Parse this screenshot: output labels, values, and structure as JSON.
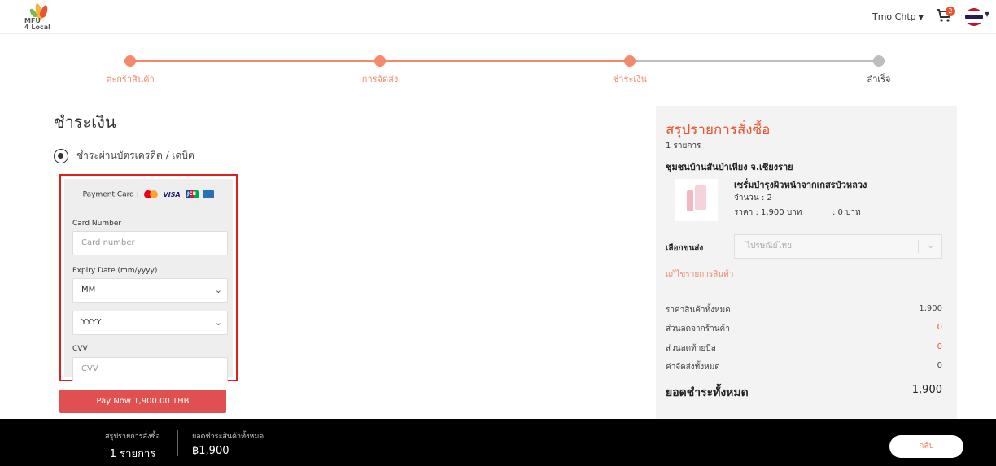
{
  "header": {
    "logo_text": "MFU\n4 Local",
    "user_name": "Tmo Chtp",
    "cart_count": "2"
  },
  "stepper": {
    "steps": [
      {
        "label": "ตะกร้าสินค้า"
      },
      {
        "label": "การจัดส่ง"
      },
      {
        "label": "ชำระเงิน"
      },
      {
        "label": "สำเร็จ"
      }
    ],
    "active_color": "#f58a6b",
    "inactive_color": "#bdbdbd"
  },
  "payment": {
    "title": "ชำระเงิน",
    "method_label": "ชำระผ่านบัตรเครดิต / เดบิต",
    "payment_card_label": "Payment Card :",
    "card_brands": [
      "mastercard-icon",
      "visa-icon",
      "jcb-icon",
      "amex-icon"
    ],
    "card_number_label": "Card Number",
    "card_number_placeholder": "Card number",
    "expiry_label": "Expiry Date (mm/yyyy)",
    "month_value": "MM",
    "year_value": "YYYY",
    "cvv_label": "CVV",
    "cvv_placeholder": "CVV",
    "pay_button": "Pay Now 1,900.00 THB"
  },
  "summary": {
    "title": "สรุปรายการสั่งซื้อ",
    "count": "1 รายการ",
    "shop": "ชุมชนบ้านสันป่าเหียง จ.เชียงราย",
    "product": {
      "name": "เซรั่มบำรุงผิวหน้าจากเกสรบัวหลวง",
      "qty": "จำนวน : 2",
      "price": "ราคา : 1,900 บาท",
      "shipping": ": 0 บาท"
    },
    "shipping_label": "เลือกขนส่ง",
    "shipping_value": "ไปรษณีย์ไทย",
    "edit_link": "แก้ไขรายการสินค้า",
    "rows": [
      {
        "label": "ราคาสินค้าทั้งหมด",
        "value": "1,900"
      },
      {
        "label": "ส่วนลดจากร้านค้า",
        "value": "0"
      },
      {
        "label": "ส่วนลดท้ายบิล",
        "value": "0"
      },
      {
        "label": "ค่าจัดส่งทั้งหมด",
        "value": "0"
      }
    ],
    "total_label": "ยอดชำระทั้งหมด",
    "total_value": "1,900"
  },
  "footer": {
    "summary_label": "สรุปรายการสั่งซื้อ",
    "summary_count": "1 รายการ",
    "total_label": "ยอดชำระสินค้าทั้งหมด",
    "total_value": "฿1,900",
    "back_button": "กลับ"
  }
}
